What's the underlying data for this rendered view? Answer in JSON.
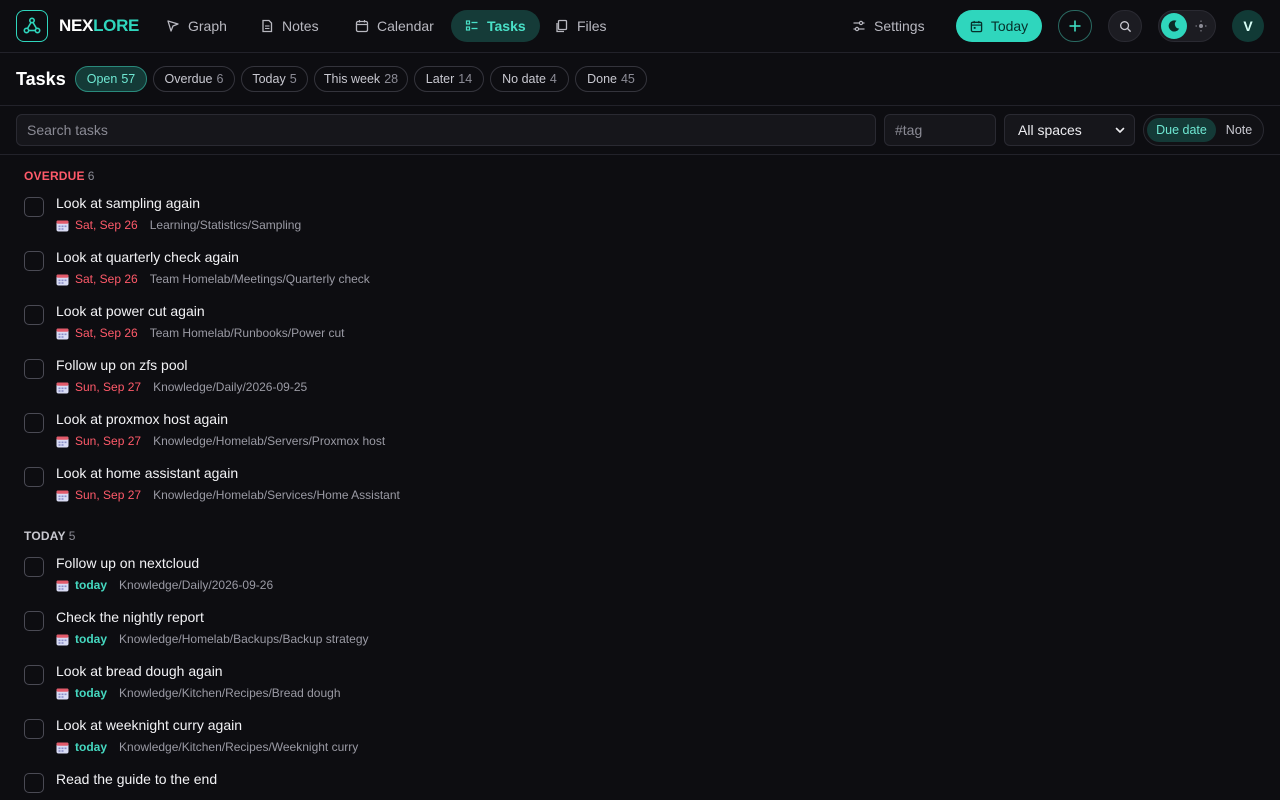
{
  "app": {
    "brand_a": "NEX",
    "brand_b": "LORE"
  },
  "nav": {
    "graph": "Graph",
    "notes": "Notes",
    "calendar": "Calendar",
    "tasks": "Tasks",
    "files": "Files",
    "settings": "Settings",
    "today_button": "Today",
    "avatar_initial": "V"
  },
  "filters": {
    "page_title": "Tasks",
    "chips": [
      {
        "label": "Open",
        "count": "57",
        "active": true
      },
      {
        "label": "Overdue",
        "count": "6"
      },
      {
        "label": "Today",
        "count": "5"
      },
      {
        "label": "This week",
        "count": "28"
      },
      {
        "label": "Later",
        "count": "14"
      },
      {
        "label": "No date",
        "count": "4"
      },
      {
        "label": "Done",
        "count": "45"
      }
    ]
  },
  "search": {
    "placeholder": "Search tasks",
    "tag_placeholder": "#tag",
    "space_selected": "All spaces",
    "sort_due": "Due date",
    "sort_note": "Note"
  },
  "groups": {
    "overdue": {
      "label": "OVERDUE",
      "count": "6",
      "tasks": [
        {
          "title": "Look at sampling again",
          "due": "Sat, Sep 26",
          "path": "Learning/Statistics/Sampling"
        },
        {
          "title": "Look at quarterly check again",
          "due": "Sat, Sep 26",
          "path": "Team Homelab/Meetings/Quarterly check"
        },
        {
          "title": "Look at power cut again",
          "due": "Sat, Sep 26",
          "path": "Team Homelab/Runbooks/Power cut"
        },
        {
          "title": "Follow up on zfs pool",
          "due": "Sun, Sep 27",
          "path": "Knowledge/Daily/2026-09-25"
        },
        {
          "title": "Look at proxmox host again",
          "due": "Sun, Sep 27",
          "path": "Knowledge/Homelab/Servers/Proxmox host"
        },
        {
          "title": "Look at home assistant again",
          "due": "Sun, Sep 27",
          "path": "Knowledge/Homelab/Services/Home Assistant"
        }
      ]
    },
    "today": {
      "label": "TODAY",
      "count": "5",
      "tasks": [
        {
          "title": "Follow up on nextcloud",
          "due": "today",
          "path": "Knowledge/Daily/2026-09-26"
        },
        {
          "title": "Check the nightly report",
          "due": "today",
          "path": "Knowledge/Homelab/Backups/Backup strategy"
        },
        {
          "title": "Look at bread dough again",
          "due": "today",
          "path": "Knowledge/Kitchen/Recipes/Bread dough"
        },
        {
          "title": "Look at weeknight curry again",
          "due": "today",
          "path": "Knowledge/Kitchen/Recipes/Weeknight curry"
        },
        {
          "title": "Read the guide to the end",
          "due": "",
          "path": ""
        }
      ]
    }
  },
  "colors": {
    "accent": "#2fd6bd",
    "overdue": "#ff5a6a",
    "background": "#0d0d11"
  }
}
